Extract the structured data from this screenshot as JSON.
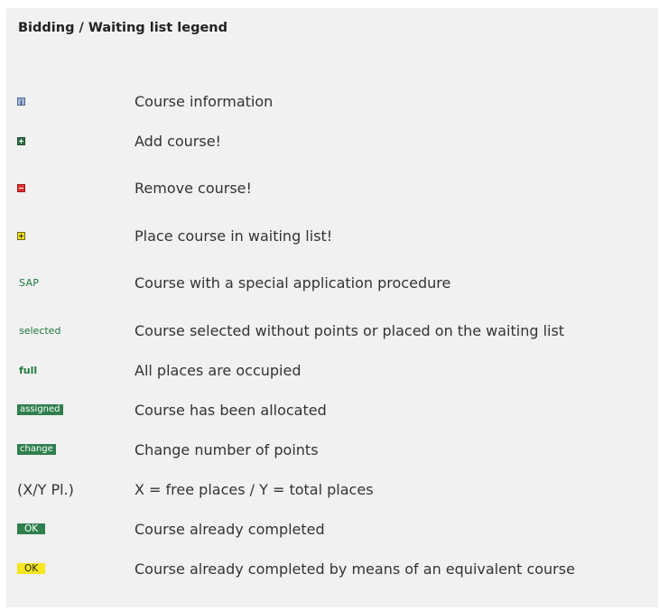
{
  "legend": {
    "title": "Bidding / Waiting list legend",
    "rows": [
      {
        "symbol": "",
        "icon": "info-icon",
        "label": "Course information"
      },
      {
        "symbol": "",
        "icon": "add-icon",
        "label": "Add course!"
      },
      {
        "symbol": "",
        "icon": "remove-icon",
        "label": "Remove course!"
      },
      {
        "symbol": "",
        "icon": "waiting-list-icon",
        "label": "Place course in waiting list!"
      },
      {
        "symbol": "SAP",
        "label": "Course with a special application procedure"
      },
      {
        "symbol": "selected",
        "label": "Course selected without points or placed on the waiting list"
      },
      {
        "symbol": "full",
        "label": "All places are occupied"
      },
      {
        "symbol": "assigned",
        "label": "Course has been allocated"
      },
      {
        "symbol": "change",
        "label": "Change number of points"
      },
      {
        "symbol": "(X/Y Pl.)",
        "label": "X = free places / Y = total places"
      },
      {
        "symbol": "OK",
        "label": "Course already completed"
      },
      {
        "symbol": "OK",
        "label": "Course already completed by means of an equivalent course"
      }
    ]
  },
  "colors": {
    "panel_bg": "#f1f1f1",
    "green": "#2f7f4e",
    "red": "#e03030",
    "yellow": "#f5e620",
    "info_blue": "#9fb7d6"
  }
}
